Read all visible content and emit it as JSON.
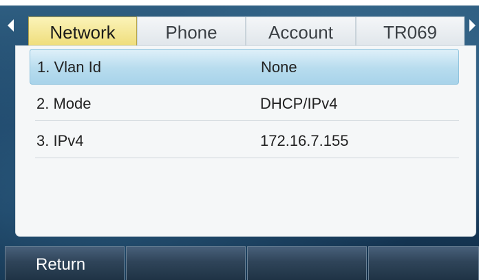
{
  "tabs": [
    {
      "label": "Network",
      "active": true
    },
    {
      "label": "Phone",
      "active": false
    },
    {
      "label": "Account",
      "active": false
    },
    {
      "label": "TR069",
      "active": false
    }
  ],
  "rows": [
    {
      "label": "1. Vlan Id",
      "value": "None",
      "selected": true
    },
    {
      "label": "2. Mode",
      "value": "DHCP/IPv4",
      "selected": false
    },
    {
      "label": "3. IPv4",
      "value": "172.16.7.155",
      "selected": false
    }
  ],
  "softkeys": [
    {
      "label": "Return"
    },
    {
      "label": ""
    },
    {
      "label": ""
    },
    {
      "label": ""
    }
  ],
  "icons": {
    "left": "arrow-left-icon",
    "right": "arrow-right-icon"
  },
  "colors": {
    "active_tab": "#eedc78",
    "selected_row": "#b7dcee",
    "background": "#1c4264"
  }
}
